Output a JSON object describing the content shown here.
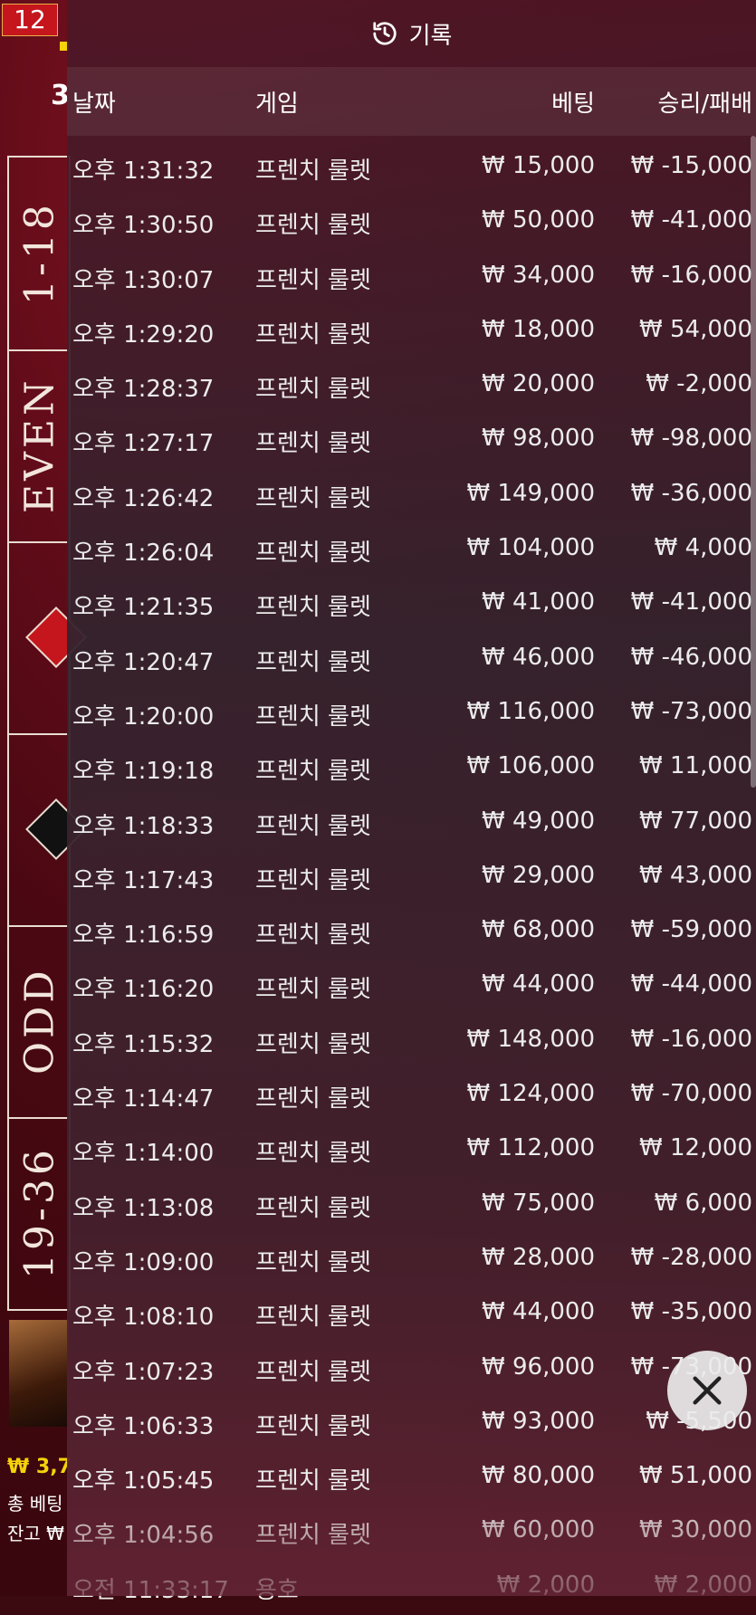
{
  "background": {
    "top_number": "12",
    "number_label": "3",
    "strip_labels": [
      "1-18",
      "EVEN",
      "",
      "",
      "ODD",
      "19-36"
    ],
    "balance_line": "₩ 3,7",
    "total_bet_line": "총 베팅",
    "balance_label": "잔고 ₩"
  },
  "panel": {
    "title": "기록",
    "title_icon": "history-icon",
    "headers": {
      "date": "날짜",
      "game": "게임",
      "bet": "베팅",
      "result": "승리/패배"
    },
    "rows": [
      {
        "date": "오후 1:31:32",
        "game": "프렌치 룰렛",
        "bet": "₩ 15,000",
        "result": "₩ -15,000"
      },
      {
        "date": "오후 1:30:50",
        "game": "프렌치 룰렛",
        "bet": "₩ 50,000",
        "result": "₩ -41,000"
      },
      {
        "date": "오후 1:30:07",
        "game": "프렌치 룰렛",
        "bet": "₩ 34,000",
        "result": "₩ -16,000"
      },
      {
        "date": "오후 1:29:20",
        "game": "프렌치 룰렛",
        "bet": "₩ 18,000",
        "result": "₩ 54,000"
      },
      {
        "date": "오후 1:28:37",
        "game": "프렌치 룰렛",
        "bet": "₩ 20,000",
        "result": "₩ -2,000"
      },
      {
        "date": "오후 1:27:17",
        "game": "프렌치 룰렛",
        "bet": "₩ 98,000",
        "result": "₩ -98,000"
      },
      {
        "date": "오후 1:26:42",
        "game": "프렌치 룰렛",
        "bet": "₩ 149,000",
        "result": "₩ -36,000"
      },
      {
        "date": "오후 1:26:04",
        "game": "프렌치 룰렛",
        "bet": "₩ 104,000",
        "result": "₩ 4,000"
      },
      {
        "date": "오후 1:21:35",
        "game": "프렌치 룰렛",
        "bet": "₩ 41,000",
        "result": "₩ -41,000"
      },
      {
        "date": "오후 1:20:47",
        "game": "프렌치 룰렛",
        "bet": "₩ 46,000",
        "result": "₩ -46,000"
      },
      {
        "date": "오후 1:20:00",
        "game": "프렌치 룰렛",
        "bet": "₩ 116,000",
        "result": "₩ -73,000"
      },
      {
        "date": "오후 1:19:18",
        "game": "프렌치 룰렛",
        "bet": "₩ 106,000",
        "result": "₩ 11,000"
      },
      {
        "date": "오후 1:18:33",
        "game": "프렌치 룰렛",
        "bet": "₩ 49,000",
        "result": "₩ 77,000"
      },
      {
        "date": "오후 1:17:43",
        "game": "프렌치 룰렛",
        "bet": "₩ 29,000",
        "result": "₩ 43,000"
      },
      {
        "date": "오후 1:16:59",
        "game": "프렌치 룰렛",
        "bet": "₩ 68,000",
        "result": "₩ -59,000"
      },
      {
        "date": "오후 1:16:20",
        "game": "프렌치 룰렛",
        "bet": "₩ 44,000",
        "result": "₩ -44,000"
      },
      {
        "date": "오후 1:15:32",
        "game": "프렌치 룰렛",
        "bet": "₩ 148,000",
        "result": "₩ -16,000"
      },
      {
        "date": "오후 1:14:47",
        "game": "프렌치 룰렛",
        "bet": "₩ 124,000",
        "result": "₩ -70,000"
      },
      {
        "date": "오후 1:14:00",
        "game": "프렌치 룰렛",
        "bet": "₩ 112,000",
        "result": "₩ 12,000"
      },
      {
        "date": "오후 1:13:08",
        "game": "프렌치 룰렛",
        "bet": "₩ 75,000",
        "result": "₩ 6,000"
      },
      {
        "date": "오후 1:09:00",
        "game": "프렌치 룰렛",
        "bet": "₩ 28,000",
        "result": "₩ -28,000"
      },
      {
        "date": "오후 1:08:10",
        "game": "프렌치 룰렛",
        "bet": "₩ 44,000",
        "result": "₩ -35,000"
      },
      {
        "date": "오후 1:07:23",
        "game": "프렌치 룰렛",
        "bet": "₩ 96,000",
        "result": "₩ -73,000"
      },
      {
        "date": "오후 1:06:33",
        "game": "프렌치 룰렛",
        "bet": "₩ 93,000",
        "result": "₩ -5,500"
      },
      {
        "date": "오후 1:05:45",
        "game": "프렌치 룰렛",
        "bet": "₩ 80,000",
        "result": "₩ 51,000"
      },
      {
        "date": "오후 1:04:56",
        "game": "프렌치 룰렛",
        "bet": "₩ 60,000",
        "result": "₩ 30,000"
      },
      {
        "date": "오전 11:33:17",
        "game": "용호",
        "bet": "₩ 2,000",
        "result": "₩ 2,000"
      }
    ],
    "close_icon": "close-icon"
  }
}
